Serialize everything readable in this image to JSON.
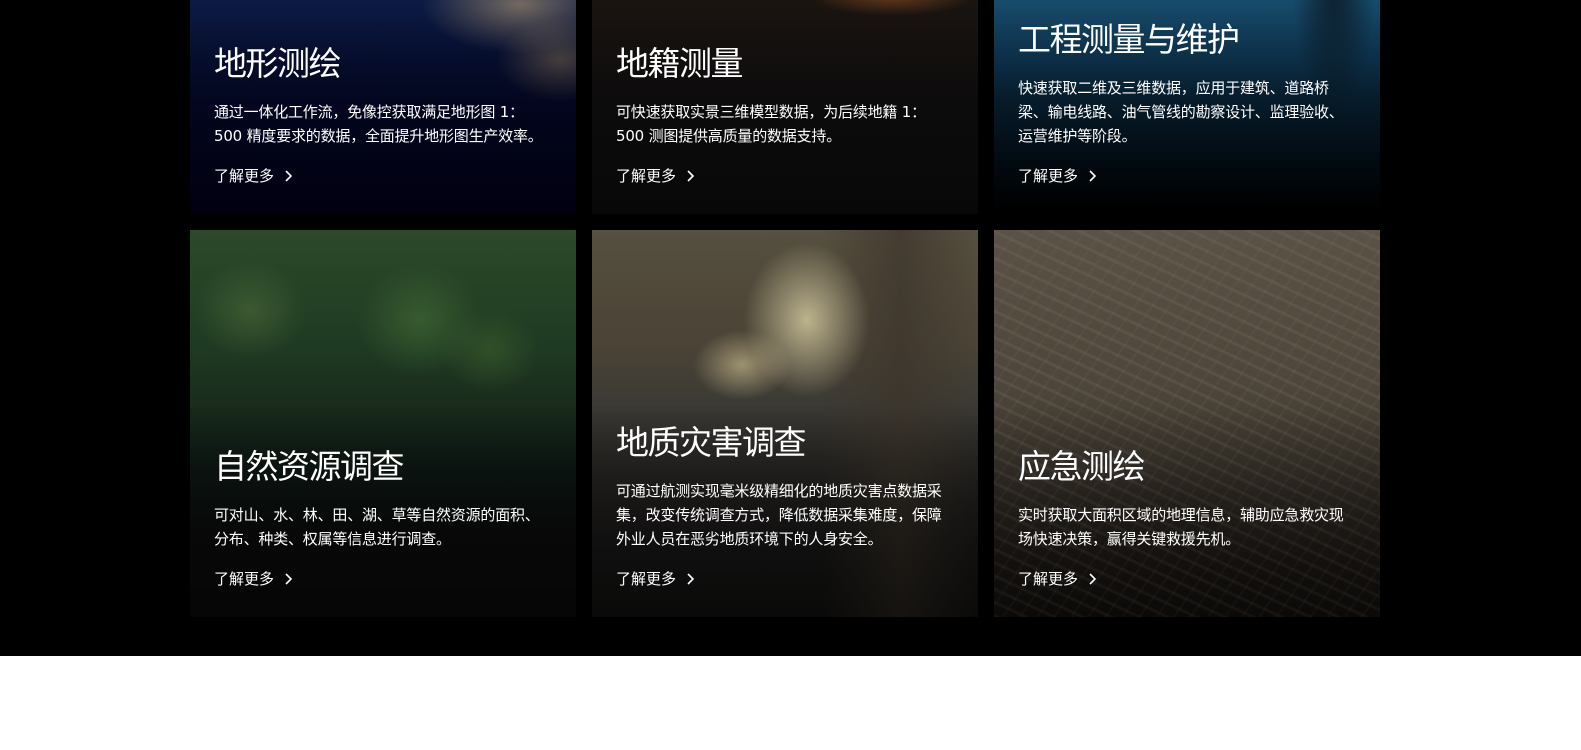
{
  "cards": [
    {
      "title": "地形测绘",
      "desc": "通过一体化工作流，免像控获取满足地形图 1：500 精度要求的数据，全面提升地形图生产效率。",
      "link": "了解更多"
    },
    {
      "title": "地籍测量",
      "desc": "可快速获取实景三维模型数据，为后续地籍 1：500 测图提供高质量的数据支持。",
      "link": "了解更多"
    },
    {
      "title": "工程测量与维护",
      "desc": "快速获取二维及三维数据，应用于建筑、道路桥梁、输电线路、油气管线的勘察设计、监理验收、运营维护等阶段。",
      "link": "了解更多"
    },
    {
      "title": "自然资源调查",
      "desc": "可对山、水、林、田、湖、草等自然资源的面积、分布、种类、权属等信息进行调查。",
      "link": "了解更多"
    },
    {
      "title": "地质灾害调查",
      "desc": "可通过航测实现毫米级精细化的地质灾害点数据采集，改变传统调查方式，降低数据采集难度，保障外业人员在恶劣地质环境下的人身安全。",
      "link": "了解更多"
    },
    {
      "title": "应急测绘",
      "desc": "实时获取大面积区域的地理信息，辅助应急救灾现场快速决策，赢得关键救援先机。",
      "link": "了解更多"
    }
  ],
  "icons": {
    "link_icon": "chevron-right-icon"
  },
  "colors": {
    "band_background": "#000000",
    "page_background": "#ffffff",
    "text": "#ffffff"
  }
}
